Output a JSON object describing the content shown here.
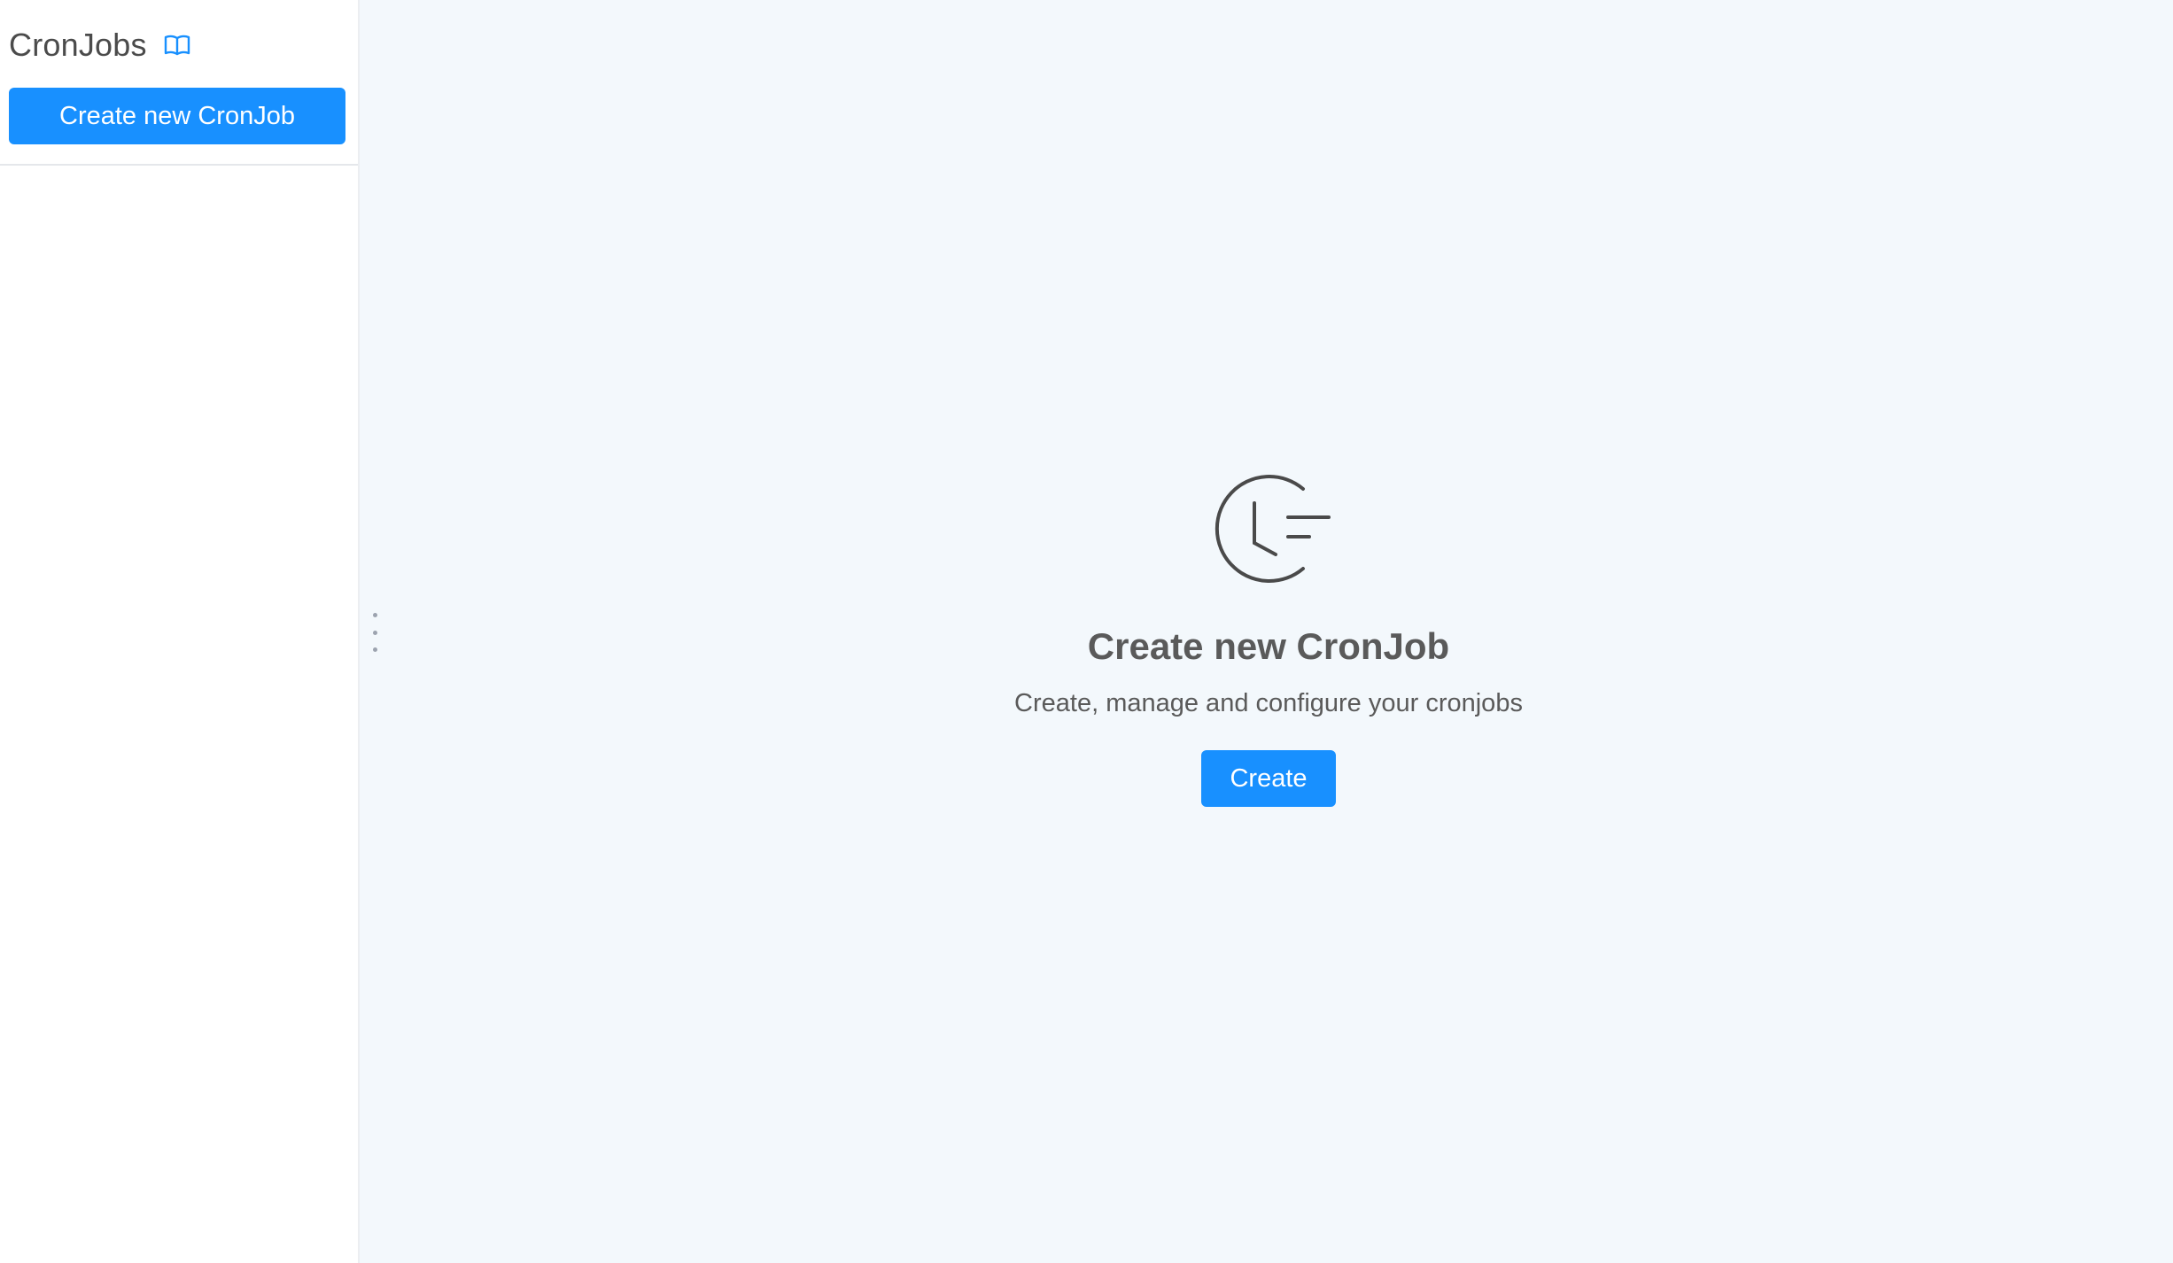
{
  "sidebar": {
    "title": "CronJobs",
    "docs_icon": "book-open-icon",
    "create_button_label": "Create new CronJob"
  },
  "empty_state": {
    "icon": "clock-schedule-icon",
    "title": "Create new CronJob",
    "subtitle": "Create, manage and configure your cronjobs",
    "create_button_label": "Create"
  },
  "colors": {
    "primary": "#1890ff",
    "background": "#f3f8fc",
    "sidebar_background": "#ffffff",
    "text": "#5a5a5a",
    "icon_stroke": "#4a4a4a"
  }
}
